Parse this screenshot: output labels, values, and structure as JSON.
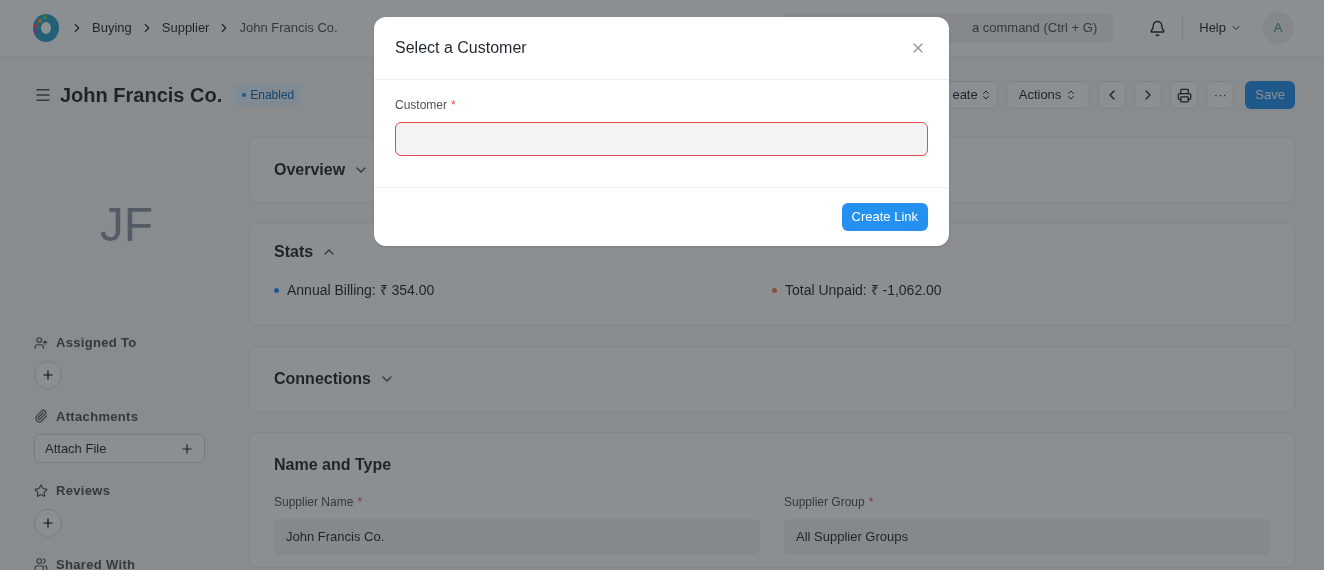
{
  "navbar": {
    "breadcrumbs": [
      "Buying",
      "Supplier",
      "John Francis Co."
    ],
    "search_placeholder": "a command (Ctrl + G)",
    "help": "Help",
    "avatar": "A"
  },
  "header": {
    "title": "John Francis Co.",
    "status": {
      "label": "Enabled",
      "color": "#1f588a"
    },
    "actions": [
      {
        "kind": "dropdown",
        "label": "eate"
      },
      {
        "kind": "dropdown",
        "label": "Actions"
      },
      {
        "kind": "prev"
      },
      {
        "kind": "next"
      },
      {
        "kind": "print"
      },
      {
        "kind": "more",
        "label": "···"
      },
      {
        "kind": "primary",
        "label": "Save"
      }
    ]
  },
  "sidebar": {
    "initials": "JF",
    "sections": [
      {
        "kind": "assign",
        "label": "Assigned To"
      },
      {
        "kind": "attach",
        "label": "Attachments",
        "button": "Attach File"
      },
      {
        "kind": "review",
        "label": "Reviews"
      },
      {
        "kind": "share",
        "label": "Shared With"
      }
    ]
  },
  "sections": [
    {
      "title": "Overview",
      "expanded": false
    },
    {
      "title": "Stats",
      "expanded": true,
      "stats": [
        {
          "label": "Annual Billing: ₹ 354.00",
          "color": "#1f588a"
        },
        {
          "label": "Total Unpaid: ₹ -1,062.00",
          "color": "#825338"
        }
      ]
    },
    {
      "title": "Connections",
      "expanded": false
    },
    {
      "title": "Name and Type",
      "fields": [
        {
          "label": "Supplier Name",
          "required_mark": "*",
          "value": "John Francis Co."
        },
        {
          "label": "Supplier Group",
          "required_mark": "*",
          "value": "All Supplier Groups"
        }
      ]
    }
  ],
  "dialog": {
    "title": "Select a Customer",
    "field": {
      "label": "Customer",
      "required_mark": "*",
      "invalid": true
    },
    "button": "Create Link"
  }
}
